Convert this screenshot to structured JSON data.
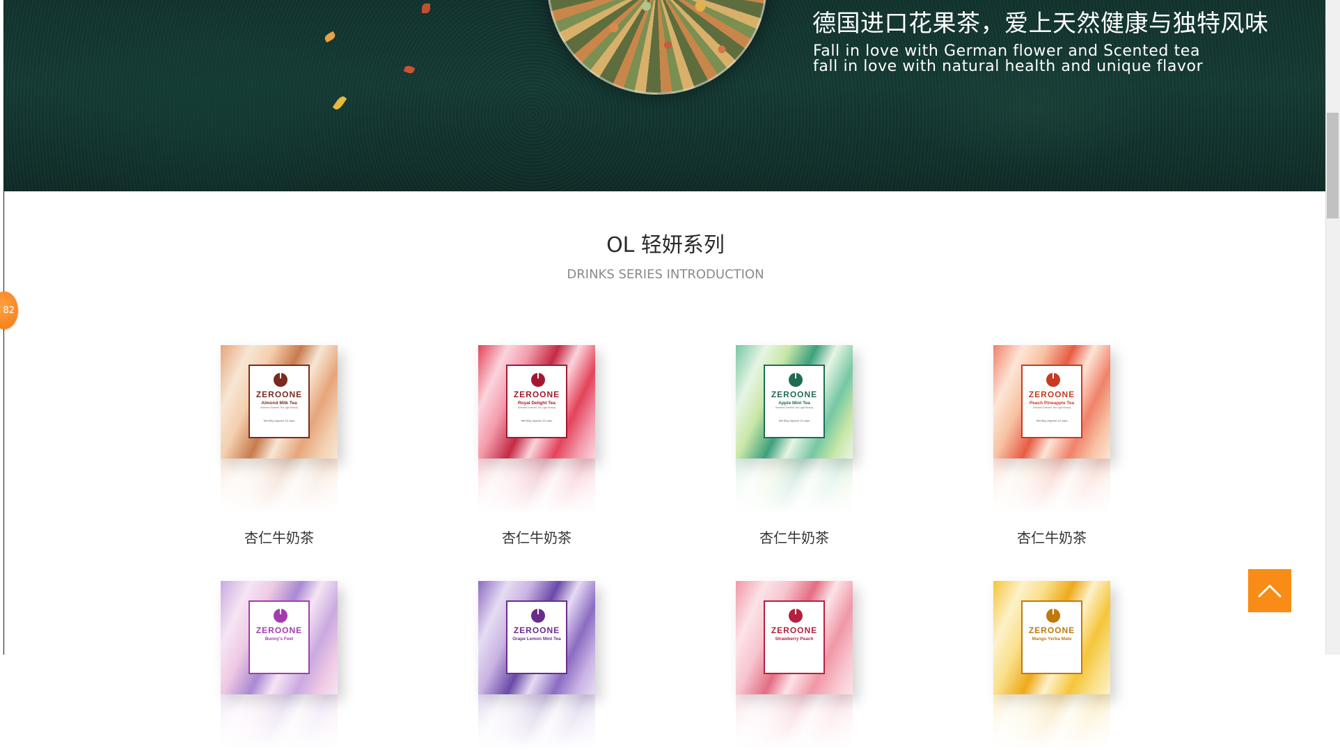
{
  "hero": {
    "title_cn": "德国进口花果茶，爱上天然健康与独特风味",
    "subtitle_en": "Fall in love with German flower and Scented tea\nfall in love with natural health and unique flavor"
  },
  "section": {
    "title": "OL 轻妍系列",
    "subtitle": "DRINKS SERIES INTRODUCTION"
  },
  "side_badge": {
    "text": "82"
  },
  "products": [
    {
      "name": "杏仁牛奶茶",
      "brand": "ZEROONE",
      "flavor": "Almond Milk Tea",
      "tiny": "Selected Scented Tea Light Beauty",
      "net": "Net 60g | Approx 10 cups",
      "colors": [
        "#e6a57a",
        "#f3cfae",
        "#c97a4d",
        "#f7e6d4"
      ],
      "accent": "#7a2b1e"
    },
    {
      "name": "杏仁牛奶茶",
      "brand": "ZEROONE",
      "flavor": "Royal Delight Tea",
      "tiny": "Selected Scented Tea Light Beauty",
      "net": "Net 60g | Approx 10 cups",
      "colors": [
        "#e3435b",
        "#f39aab",
        "#c32a44",
        "#fbd4dc"
      ],
      "accent": "#a2192f"
    },
    {
      "name": "杏仁牛奶茶",
      "brand": "ZEROONE",
      "flavor": "Apple Mint Tea",
      "tiny": "Selected Scented Tea Light Beauty",
      "net": "Net 60g | Approx 10 cups",
      "colors": [
        "#76c7a4",
        "#c9e7a7",
        "#3da07d",
        "#e6f5e4"
      ],
      "accent": "#1f6b53"
    },
    {
      "name": "杏仁牛奶茶",
      "brand": "ZEROONE",
      "flavor": "Peach Pineapple Tea",
      "tiny": "Selected Scented Tea Light Beauty",
      "net": "Net 60g | Approx 10 cups",
      "colors": [
        "#f0826a",
        "#f8c2a3",
        "#e75c45",
        "#fde5d6"
      ],
      "accent": "#c93a22"
    },
    {
      "name": "",
      "brand": "ZEROONE",
      "flavor": "Bunny's Feet",
      "tiny": "",
      "net": "",
      "colors": [
        "#c9a9e0",
        "#efc9e4",
        "#a989d2",
        "#f6e5f4"
      ],
      "accent": "#a23cae"
    },
    {
      "name": "",
      "brand": "ZEROONE",
      "flavor": "Grape Lemon Mint Tea",
      "tiny": "",
      "net": "",
      "colors": [
        "#8b6cc2",
        "#c9b3e3",
        "#6a4aa8",
        "#e6dcf3"
      ],
      "accent": "#6a2c8a"
    },
    {
      "name": "",
      "brand": "ZEROONE",
      "flavor": "Strawberry Peach",
      "tiny": "",
      "net": "",
      "colors": [
        "#f097a6",
        "#f7c5cf",
        "#e46d82",
        "#fce3e8"
      ],
      "accent": "#b4203d"
    },
    {
      "name": "",
      "brand": "ZEROONE",
      "flavor": "Mango Yerba Mate",
      "tiny": "",
      "net": "",
      "colors": [
        "#f5c53a",
        "#f9e08a",
        "#eeaa1c",
        "#fdf1c9"
      ],
      "accent": "#c0790e"
    }
  ]
}
